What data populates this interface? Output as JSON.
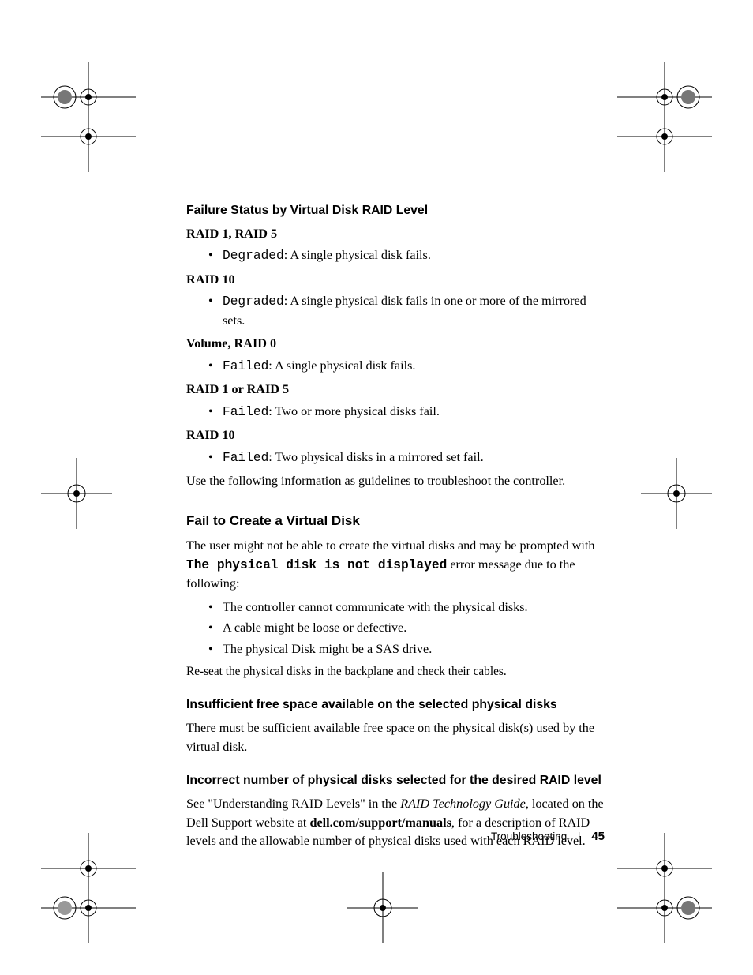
{
  "section1": {
    "heading": "Failure Status by Virtual Disk RAID Level",
    "groups": [
      {
        "title": "RAID 1, RAID 5",
        "status": "Degraded",
        "desc": ": A single physical disk fails."
      },
      {
        "title": "RAID 10",
        "status": "Degraded",
        "desc": ": A single physical disk fails in one or more of the mirrored sets."
      },
      {
        "title": "Volume, RAID 0",
        "status": "Failed",
        "desc": ": A single physical disk fails."
      },
      {
        "title": "RAID 1 or RAID 5",
        "status": "Failed",
        "desc": ": Two or more physical disks fail."
      },
      {
        "title": "RAID 10",
        "status": "Failed",
        "desc": ": Two physical disks in a mirrored set fail."
      }
    ],
    "footnote": "Use the following information as guidelines to troubleshoot the controller."
  },
  "section2": {
    "heading": "Fail to Create a Virtual Disk",
    "intro_pre": "The user might not be able to create the virtual disks and may be prompted with ",
    "intro_code": "The physical disk is not displayed",
    "intro_post": " error message due to the following:",
    "bullets": [
      "The controller cannot communicate with the physical disks.",
      "A cable might be loose or defective.",
      "The physical Disk might be a SAS drive."
    ],
    "trailer": "Re-seat the physical disks in the backplane and check their cables."
  },
  "section3": {
    "heading": "Insufficient free space available on the selected physical disks",
    "body": "There must be sufficient available free space on the physical disk(s) used by the virtual disk."
  },
  "section4": {
    "heading": "Incorrect number of physical disks selected for the desired RAID level",
    "pre": "See \"Understanding RAID Levels\" in the ",
    "italic": "RAID Technology Guide",
    "mid": ", located on the Dell Support website at ",
    "bold": "dell.com/support/manuals",
    "post": ", for a description of RAID levels and the allowable number of physical disks used with each RAID level."
  },
  "footer": {
    "section": "Troubleshooting",
    "page": "45"
  }
}
